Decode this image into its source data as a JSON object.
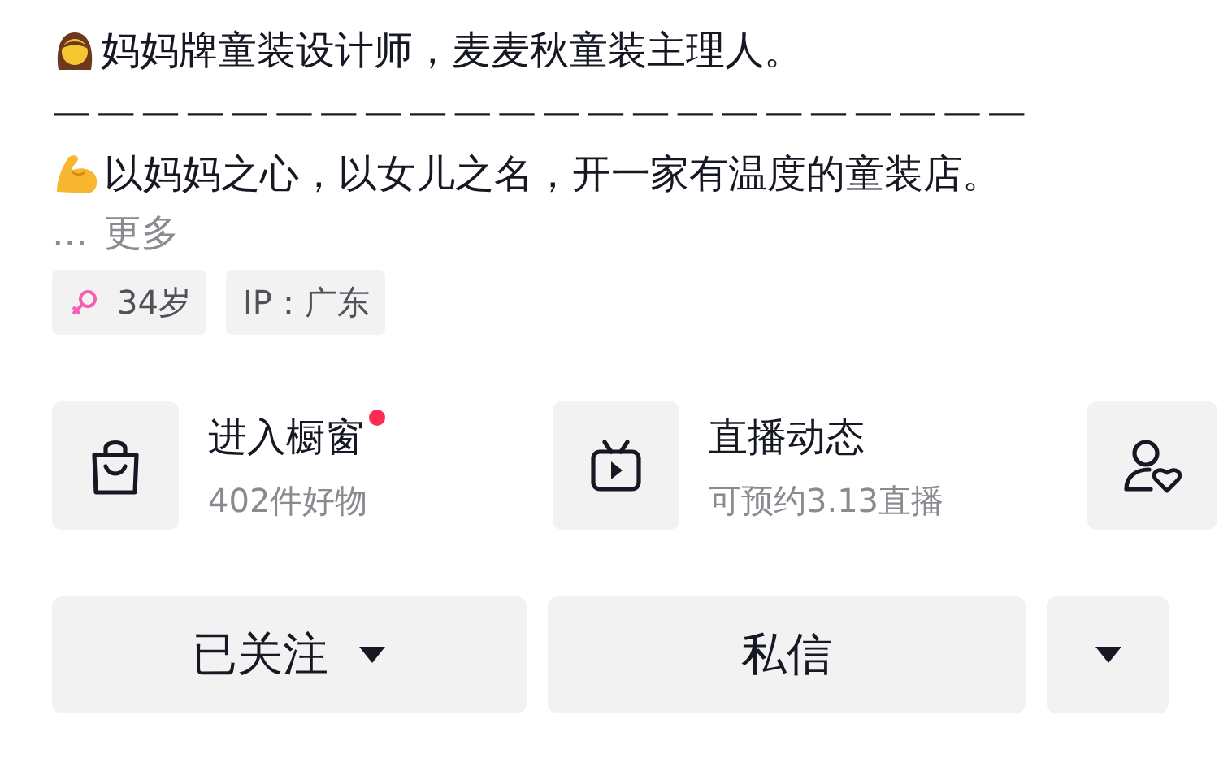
{
  "bio": {
    "lines": [
      {
        "kind": "woman",
        "text": "妈妈牌童装设计师，麦麦秋童装主理人。"
      },
      {
        "kind": "plain",
        "text": "——————————————————————"
      },
      {
        "kind": "muscle",
        "text": "以妈妈之心，以女儿之名，开一家有温度的童装店。"
      }
    ],
    "more": {
      "ellipsis": "...",
      "label": "更多"
    }
  },
  "tags": [
    {
      "kind": "gender",
      "text": "34岁"
    },
    {
      "kind": "plain",
      "text": "IP：广东"
    }
  ],
  "cards": [
    {
      "kind": "shop",
      "title": "进入橱窗",
      "subtitle": "402件好物",
      "dot": true
    },
    {
      "kind": "live",
      "title": "直播动态",
      "subtitle": "可预约3.13直播",
      "dot": false
    }
  ],
  "buttons": [
    {
      "kind": "dropdown",
      "label": "已关注"
    },
    {
      "kind": "plain",
      "label": "私信"
    },
    {
      "kind": "caret"
    }
  ]
}
